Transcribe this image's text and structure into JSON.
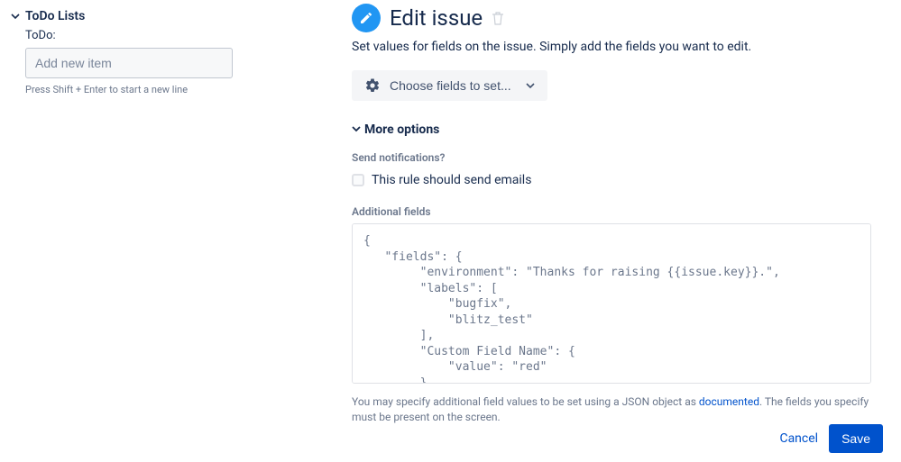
{
  "left": {
    "title": "ToDo Lists",
    "sub": "ToDo:",
    "input_placeholder": "Add new item",
    "hint": "Press Shift + Enter to start a new line"
  },
  "main": {
    "title": "Edit issue",
    "description": "Set values for fields on the issue. Simply add the fields you want to edit.",
    "choose_label": "Choose fields to set...",
    "more_options": "More options",
    "send_notifications_label": "Send notifications?",
    "send_emails_label": "This rule should send emails",
    "additional_fields_label": "Additional fields",
    "code": "{\n   \"fields\": {\n        \"environment\": \"Thanks for raising {{issue.key}}.\",\n        \"labels\": [\n            \"bugfix\",\n            \"blitz_test\"\n        ],\n        \"Custom Field Name\": {\n            \"value\": \"red\"\n        }",
    "help_pre": "You may specify additional field values to be set using a JSON object as ",
    "help_link": "documented",
    "help_post": ". The fields you specify must be present on the screen.",
    "cancel": "Cancel",
    "save": "Save"
  }
}
